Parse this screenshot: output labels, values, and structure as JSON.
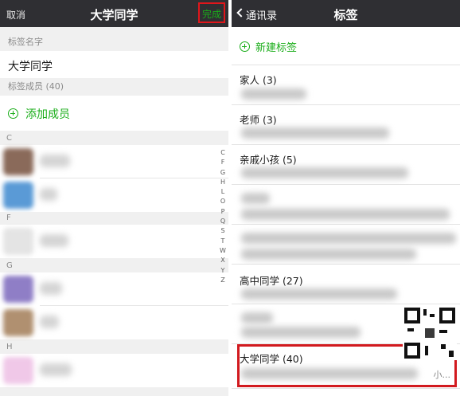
{
  "left": {
    "nav": {
      "cancel": "取消",
      "title": "大学同学",
      "done": "完成"
    },
    "tag_name_header": "标签名字",
    "tag_name_value": "大学同学",
    "members_header": "标签成员 (40)",
    "add_member": "添加成员",
    "sections": [
      "C",
      "F",
      "G",
      "H"
    ],
    "index_letters": [
      "C",
      "F",
      "G",
      "H",
      "L",
      "O",
      "P",
      "Q",
      "S",
      "T",
      "W",
      "X",
      "Y",
      "Z"
    ]
  },
  "right": {
    "nav": {
      "back": "通讯录",
      "title": "标签"
    },
    "new_tag": "新建标签",
    "tags": [
      {
        "title": "家人 (3)"
      },
      {
        "title": "老师 (3)"
      },
      {
        "title": "亲戚小孩 (5)"
      },
      {
        "title": ""
      },
      {
        "title": ""
      },
      {
        "title": "高中同学 (27)"
      },
      {
        "title": ""
      },
      {
        "title": "大学同学 (40)"
      }
    ],
    "trailing_text": "小..."
  },
  "colors": {
    "navbar": "#2f2f33",
    "accent_green": "#1aad19",
    "highlight_red": "#d21a1f"
  }
}
